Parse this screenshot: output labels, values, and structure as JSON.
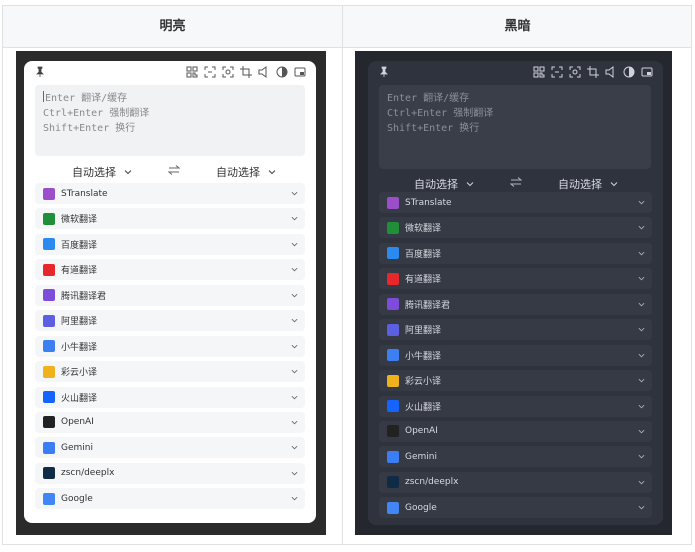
{
  "table": {
    "headers": [
      "明亮",
      "黑暗"
    ]
  },
  "panel": {
    "input_lines": [
      "Enter 翻译/缓存",
      "Ctrl+Enter 强制翻译",
      "Shift+Enter 换行"
    ],
    "source_lang": "自动选择",
    "target_lang": "自动选择",
    "toolbar_icons": [
      "qr-scan-icon",
      "ocr-icon",
      "screenshot-translate-icon",
      "crop-icon",
      "speak-icon",
      "theme-toggle-icon",
      "window-icon"
    ],
    "services": [
      {
        "name": "STranslate",
        "icon": "stranslate-icon",
        "color": "#9b4dca"
      },
      {
        "name": "微软翻译",
        "icon": "microsoft-translate-icon",
        "color": "#1f8f3a"
      },
      {
        "name": "百度翻译",
        "icon": "baidu-translate-icon",
        "color": "#2b8af0"
      },
      {
        "name": "有道翻译",
        "icon": "youdao-translate-icon",
        "color": "#e8272d"
      },
      {
        "name": "腾讯翻译君",
        "icon": "tencent-translate-icon",
        "color": "#7d4cdb"
      },
      {
        "name": "阿里翻译",
        "icon": "ali-translate-icon",
        "color": "#5b5fe0"
      },
      {
        "name": "小牛翻译",
        "icon": "niutrans-icon",
        "color": "#3c7ff0"
      },
      {
        "name": "彩云小译",
        "icon": "caiyun-icon",
        "color": "#f0b21c"
      },
      {
        "name": "火山翻译",
        "icon": "volcengine-icon",
        "color": "#1664ff"
      },
      {
        "name": "OpenAI",
        "icon": "openai-icon",
        "color": "#222222"
      },
      {
        "name": "Gemini",
        "icon": "gemini-icon",
        "color": "#3b7df2"
      },
      {
        "name": "zscn/deeplx",
        "icon": "deeplx-icon",
        "color": "#0f2b46"
      },
      {
        "name": "Google",
        "icon": "google-translate-icon",
        "color": "#4285f4"
      }
    ]
  },
  "colors": {
    "light_bg": "#ffffff",
    "dark_bg": "#2f333d"
  }
}
